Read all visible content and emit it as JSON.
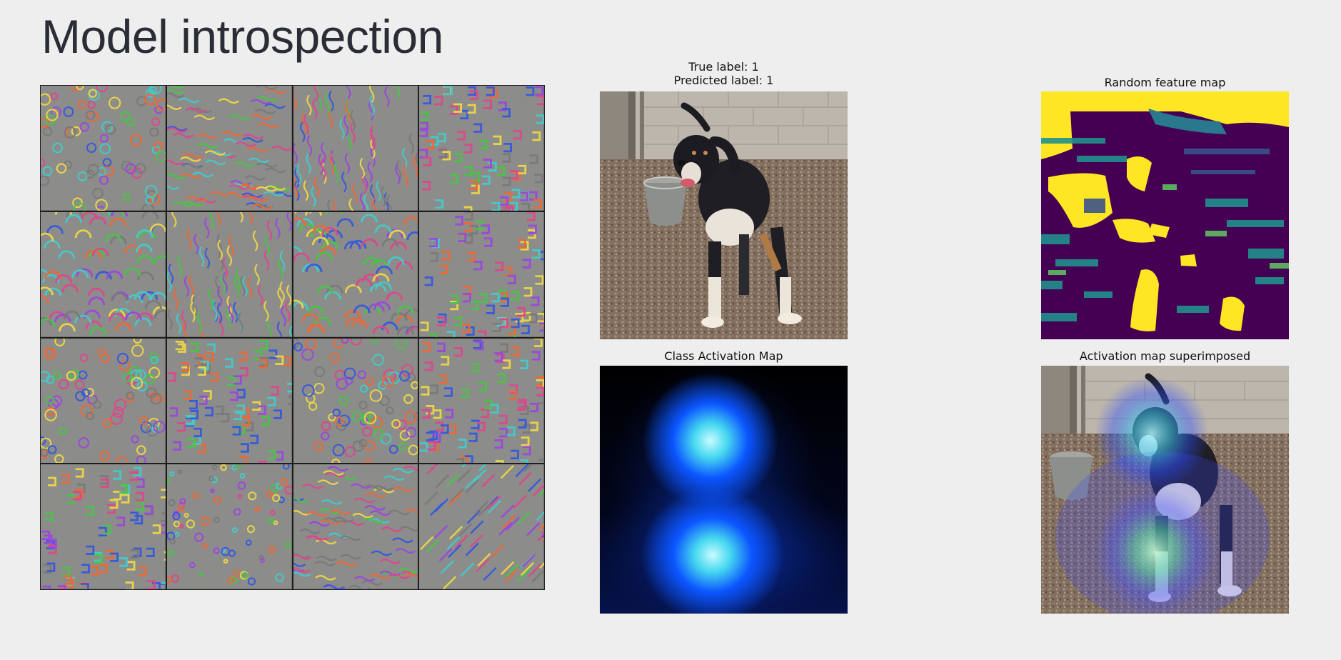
{
  "slide": {
    "title": "Model introspection"
  },
  "filter_grid": {
    "rows": 4,
    "cols": 4,
    "tiles": [
      {
        "pattern": "dots",
        "hue": 0
      },
      {
        "pattern": "horizontal-waves",
        "hue": 40
      },
      {
        "pattern": "vertical-strands",
        "hue": 300
      },
      {
        "pattern": "maze",
        "hue": 200
      },
      {
        "pattern": "swirls",
        "hue": 320
      },
      {
        "pattern": "vertical-fine",
        "hue": 120
      },
      {
        "pattern": "scales",
        "hue": 60
      },
      {
        "pattern": "braids",
        "hue": 280
      },
      {
        "pattern": "eyes",
        "hue": 220
      },
      {
        "pattern": "mesh",
        "hue": 20
      },
      {
        "pattern": "florets",
        "hue": 140
      },
      {
        "pattern": "cells",
        "hue": 350
      },
      {
        "pattern": "worms",
        "hue": 100
      },
      {
        "pattern": "speckle",
        "hue": 260
      },
      {
        "pattern": "stitches",
        "hue": 30
      },
      {
        "pattern": "diagonal-fan",
        "hue": 0
      }
    ]
  },
  "panels": {
    "original": {
      "caption_line1": "True label: 1",
      "caption_line2": "Predicted label: 1"
    },
    "feature_map": {
      "caption": "Random feature map"
    },
    "cam": {
      "caption": "Class Activation Map"
    },
    "superimposed": {
      "caption": "Activation map superimposed"
    }
  },
  "colors": {
    "background": "#eeeeef",
    "title": "#2b2d36",
    "viridis_dark": "#440154",
    "viridis_mid": "#21918c",
    "viridis_bright": "#fde725",
    "cam_glow": "#9ff2ff",
    "cam_blue": "#0a4bff"
  }
}
